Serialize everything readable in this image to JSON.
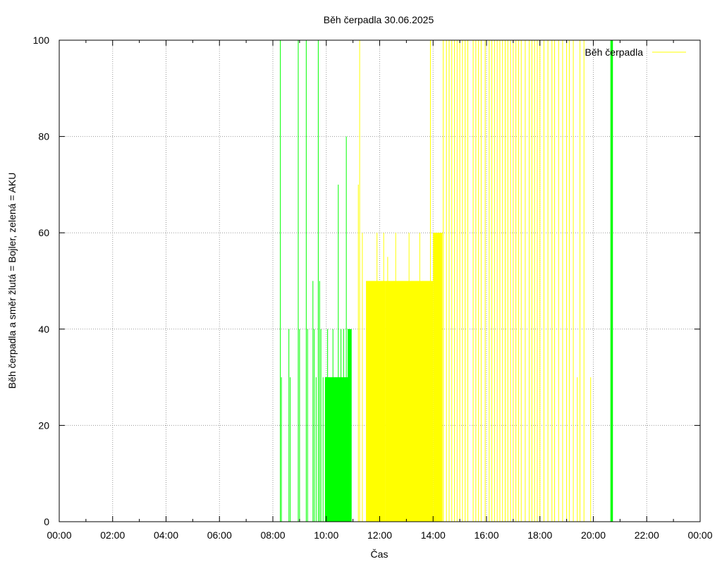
{
  "chart_data": {
    "type": "bar",
    "title": "Běh čerpadla 30.06.2025",
    "xlabel": "Čas",
    "ylabel": "Běh čerpadla a směr žlutá = Bojler, zelená = AKU",
    "xlim": [
      0,
      24
    ],
    "ylim": [
      0,
      100
    ],
    "x_unit": "hours",
    "x_ticks": [
      "00:00",
      "02:00",
      "04:00",
      "06:00",
      "08:00",
      "10:00",
      "12:00",
      "14:00",
      "16:00",
      "18:00",
      "20:00",
      "22:00",
      "00:00"
    ],
    "y_ticks": [
      "0",
      "20",
      "40",
      "60",
      "80",
      "100"
    ],
    "grid": true,
    "legend": {
      "position": "top-right",
      "entries": [
        {
          "label": "Běh čerpadla",
          "color": "#ffff00"
        }
      ]
    },
    "series": [
      {
        "name": "Běh čerpadla",
        "color": "#ffff00",
        "impulses": [
          [
            11.2,
            70
          ],
          [
            11.25,
            100
          ],
          [
            11.35,
            60
          ],
          [
            11.5,
            50
          ],
          [
            11.7,
            50
          ],
          [
            11.9,
            60
          ],
          [
            12.15,
            60
          ],
          [
            12.3,
            55
          ],
          [
            12.6,
            60
          ],
          [
            12.8,
            45
          ],
          [
            13.1,
            60
          ],
          [
            13.3,
            40
          ],
          [
            13.5,
            60
          ],
          [
            13.65,
            45
          ],
          [
            13.9,
            100
          ],
          [
            14.38,
            100
          ],
          [
            14.5,
            100
          ],
          [
            14.6,
            100
          ],
          [
            14.7,
            100
          ],
          [
            14.8,
            100
          ],
          [
            14.9,
            100
          ],
          [
            15.0,
            100
          ],
          [
            15.1,
            100
          ],
          [
            15.2,
            100
          ],
          [
            15.3,
            100
          ],
          [
            15.5,
            100
          ],
          [
            15.6,
            100
          ],
          [
            15.7,
            100
          ],
          [
            15.8,
            100
          ],
          [
            15.95,
            100
          ],
          [
            16.1,
            100
          ],
          [
            16.2,
            100
          ],
          [
            16.3,
            100
          ],
          [
            16.4,
            100
          ],
          [
            16.5,
            100
          ],
          [
            16.6,
            100
          ],
          [
            16.7,
            100
          ],
          [
            16.8,
            100
          ],
          [
            16.9,
            100
          ],
          [
            17.0,
            100
          ],
          [
            17.1,
            100
          ],
          [
            17.2,
            100
          ],
          [
            17.3,
            100
          ],
          [
            17.45,
            100
          ],
          [
            17.6,
            100
          ],
          [
            17.7,
            100
          ],
          [
            17.8,
            100
          ],
          [
            17.9,
            100
          ],
          [
            18.0,
            100
          ],
          [
            18.15,
            100
          ],
          [
            18.3,
            100
          ],
          [
            18.45,
            100
          ],
          [
            18.55,
            100
          ],
          [
            18.7,
            100
          ],
          [
            18.85,
            100
          ],
          [
            19.0,
            100
          ],
          [
            19.1,
            100
          ],
          [
            19.25,
            100
          ],
          [
            19.4,
            30
          ],
          [
            19.5,
            100
          ],
          [
            19.65,
            100
          ],
          [
            19.9,
            30
          ]
        ],
        "blocks": [
          [
            11.5,
            12.2,
            50
          ],
          [
            12.2,
            13.5,
            50
          ],
          [
            13.5,
            14.0,
            50
          ],
          [
            14.0,
            14.35,
            60
          ]
        ]
      },
      {
        "name": "AKU",
        "color": "#00ff00",
        "impulses": [
          [
            8.28,
            100
          ],
          [
            8.32,
            30
          ],
          [
            8.6,
            40
          ],
          [
            8.65,
            30
          ],
          [
            8.95,
            100
          ],
          [
            9.0,
            40
          ],
          [
            9.25,
            100
          ],
          [
            9.3,
            40
          ],
          [
            9.5,
            50
          ],
          [
            9.55,
            40
          ],
          [
            9.62,
            30
          ],
          [
            9.7,
            100
          ],
          [
            9.75,
            50
          ],
          [
            9.8,
            40
          ],
          [
            9.88,
            30
          ],
          [
            10.05,
            40
          ],
          [
            10.25,
            40
          ],
          [
            10.35,
            30
          ],
          [
            10.45,
            70
          ],
          [
            10.55,
            40
          ],
          [
            10.65,
            40
          ],
          [
            10.75,
            80
          ],
          [
            10.85,
            40
          ],
          [
            20.65,
            100
          ],
          [
            20.68,
            100
          ],
          [
            20.7,
            100
          ],
          [
            20.72,
            100
          ]
        ],
        "blocks": [
          [
            9.95,
            10.45,
            30
          ],
          [
            10.45,
            10.9,
            30
          ],
          [
            10.8,
            10.95,
            40
          ]
        ]
      }
    ]
  }
}
